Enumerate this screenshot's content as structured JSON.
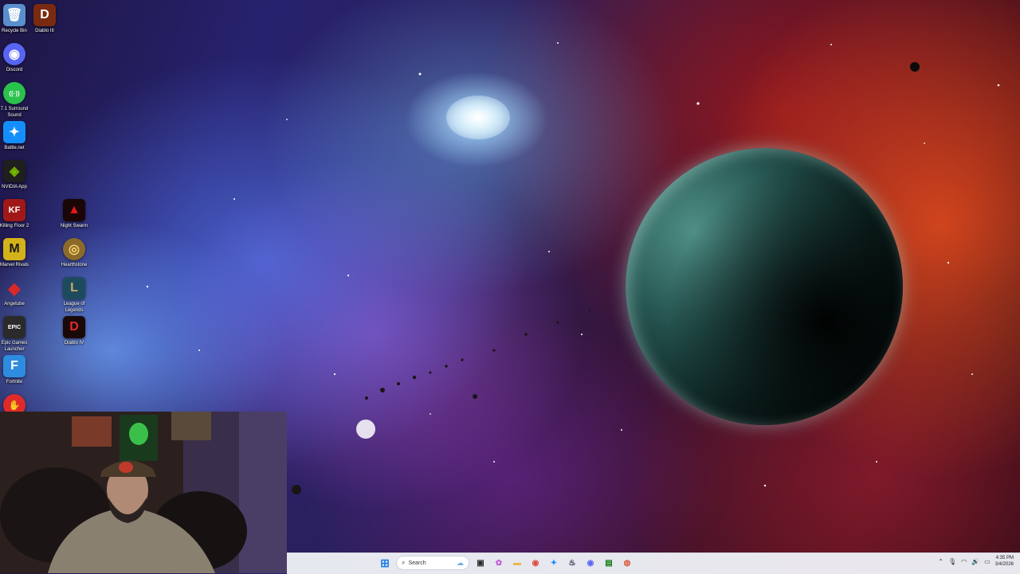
{
  "desktop": {
    "icons": [
      {
        "label": "Recycle Bin",
        "glyph": "🗑",
        "color": "#5a8fcf"
      },
      {
        "label": "Diablo III",
        "glyph": "D",
        "color": "#7a2a10"
      },
      {
        "label": "Discord",
        "glyph": "◉",
        "color": "#5865f2"
      },
      {
        "label": "7.1 Surround Sound",
        "glyph": "((·))",
        "color": "#2bc14d"
      },
      {
        "label": "Battle.net",
        "glyph": "✦",
        "color": "#148eff"
      },
      {
        "label": "NVIDIA App",
        "glyph": "◈",
        "color": "#76b900"
      },
      {
        "label": "Killing Floor 2",
        "glyph": "KF",
        "color": "#a01818"
      },
      {
        "label": "Night Swarm",
        "glyph": "▲",
        "color": "#c01010"
      },
      {
        "label": "Marvel Rivals",
        "glyph": "M",
        "color": "#d4b21a"
      },
      {
        "label": "Hearthstone",
        "glyph": "◎",
        "color": "#8c6a2a"
      },
      {
        "label": "Angetube",
        "glyph": "◆",
        "color": "#d82828"
      },
      {
        "label": "League of Legends",
        "glyph": "L",
        "color": "#1d4b5e"
      },
      {
        "label": "Epic Games Launcher",
        "glyph": "EPIC",
        "color": "#2a2a2a"
      },
      {
        "label": "Diablo IV",
        "glyph": "D",
        "color": "#9a1a1a"
      },
      {
        "label": "Fortnite",
        "glyph": "F",
        "color": "#2e8ce0"
      },
      {
        "label": "",
        "glyph": "✋",
        "color": "#e02a2a"
      }
    ]
  },
  "taskbar": {
    "search_placeholder": "Search",
    "apps": [
      {
        "name": "start-button",
        "glyph": "⊞",
        "color": "#1f7fe0"
      },
      {
        "name": "widgets-button",
        "glyph": "☁",
        "color": "#6bb0e0"
      },
      {
        "name": "task-view-button",
        "glyph": "▣",
        "color": "#2b2b2b"
      },
      {
        "name": "copilot-button",
        "glyph": "✿",
        "color": "#c15ad2"
      },
      {
        "name": "file-explorer-button",
        "glyph": "▬",
        "color": "#e8b84a"
      },
      {
        "name": "chrome-button",
        "glyph": "◉",
        "color": "#e04a3a"
      },
      {
        "name": "battlenet-taskbar-button",
        "glyph": "✦",
        "color": "#148eff"
      },
      {
        "name": "steam-button",
        "glyph": "♨",
        "color": "#1b2838"
      },
      {
        "name": "discord-taskbar-button",
        "glyph": "◉",
        "color": "#5865f2"
      },
      {
        "name": "xbox-button",
        "glyph": "▤",
        "color": "#107c10"
      },
      {
        "name": "app-button",
        "glyph": "◍",
        "color": "#d85a3a"
      }
    ],
    "time": "4:35 PM",
    "date": "3/4/2026"
  }
}
